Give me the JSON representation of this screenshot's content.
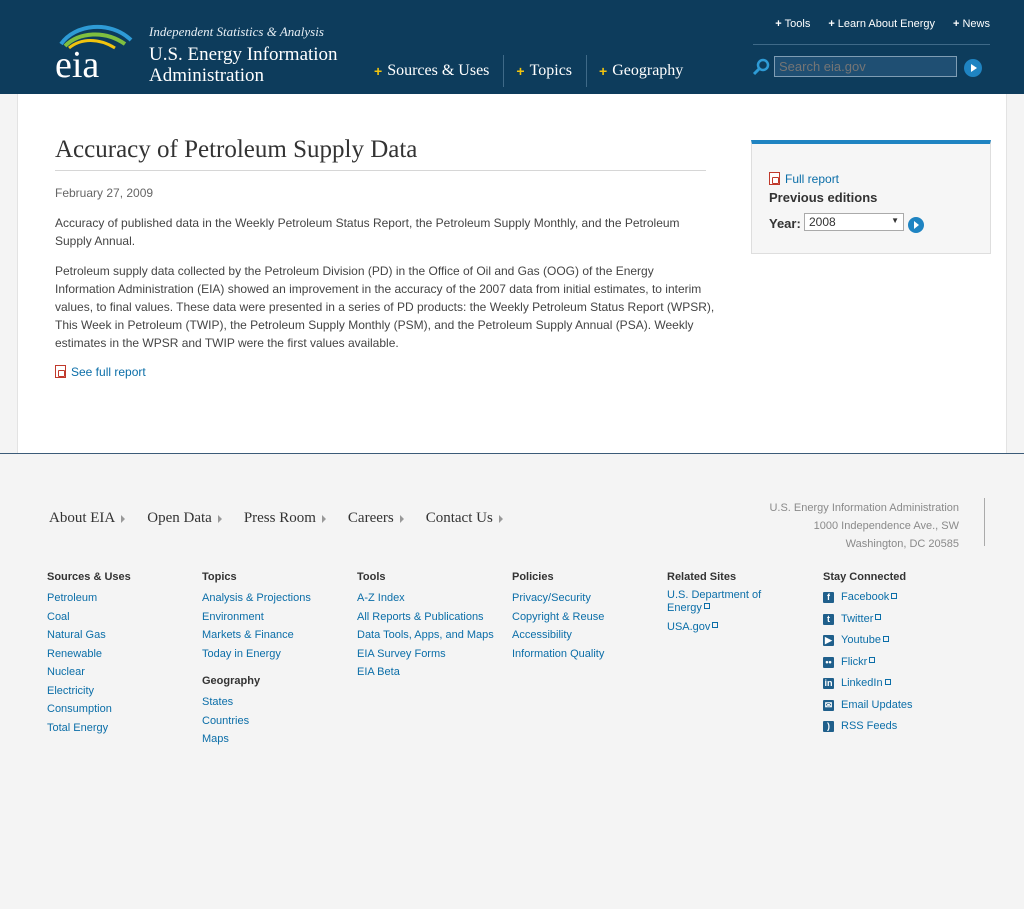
{
  "header": {
    "tagline": "Independent Statistics & Analysis",
    "org_line1": "U.S. Energy Information",
    "org_line2": "Administration",
    "logo_text": "eia",
    "main_nav": [
      "Sources & Uses",
      "Topics",
      "Geography"
    ],
    "top_nav": [
      "Tools",
      "Learn About Energy",
      "News"
    ],
    "search_placeholder": "Search eia.gov"
  },
  "article": {
    "title": "Accuracy of Petroleum Supply Data",
    "date": "February 27, 2009",
    "para1": "Accuracy of published data in the Weekly Petroleum Status Report, the Petroleum Supply Monthly, and the Petroleum Supply Annual.",
    "para2": "Petroleum supply data collected by the Petroleum Division (PD) in the Office of Oil and Gas (OOG) of the Energy Information Administration (EIA) showed an improvement in the accuracy of the 2007 data from initial estimates, to interim values, to final values. These data were presented in a series of PD products: the Weekly Petroleum Status Report (WPSR), This Week in Petroleum (TWIP), the Petroleum Supply Monthly (PSM), and the Petroleum Supply Annual (PSA). Weekly estimates in the WPSR and TWIP were the first values available.",
    "see_full_report": "See full report"
  },
  "sidebar": {
    "full_report": "Full report",
    "previous_editions": "Previous editions",
    "year_label": "Year:",
    "year_value": "2008"
  },
  "footer": {
    "nav": [
      "About EIA",
      "Open Data",
      "Press Room",
      "Careers",
      "Contact Us"
    ],
    "address": [
      "U.S. Energy Information Administration",
      "1000 Independence Ave., SW",
      "Washington, DC 20585"
    ],
    "sources_uses": {
      "heading": "Sources & Uses",
      "links": [
        "Petroleum",
        "Coal",
        "Natural Gas",
        "Renewable",
        "Nuclear",
        "Electricity",
        "Consumption",
        "Total Energy"
      ]
    },
    "topics": {
      "heading": "Topics",
      "links": [
        "Analysis & Projections",
        "Environment",
        "Markets & Finance",
        "Today in Energy"
      ]
    },
    "geography": {
      "heading": "Geography",
      "links": [
        "States",
        "Countries",
        "Maps"
      ]
    },
    "tools": {
      "heading": "Tools",
      "links": [
        "A-Z Index",
        "All Reports & Publications",
        "Data Tools, Apps, and Maps",
        "EIA Survey Forms",
        "EIA Beta"
      ]
    },
    "policies": {
      "heading": "Policies",
      "links": [
        "Privacy/Security",
        "Copyright & Reuse",
        "Accessibility",
        "Information Quality"
      ]
    },
    "related": {
      "heading": "Related Sites",
      "link1_line1": "U.S. Department of",
      "link1_line2": "Energy",
      "link2": "USA.gov"
    },
    "social": {
      "heading": "Stay Connected",
      "links": [
        "Facebook",
        "Twitter",
        "Youtube",
        "Flickr",
        "LinkedIn",
        "Email Updates",
        "RSS Feeds"
      ]
    }
  },
  "colors": {
    "header_bg": "#0d3c5c",
    "link": "#0b6ea8",
    "accent": "#1f84c2",
    "plus": "#f1c40f"
  }
}
